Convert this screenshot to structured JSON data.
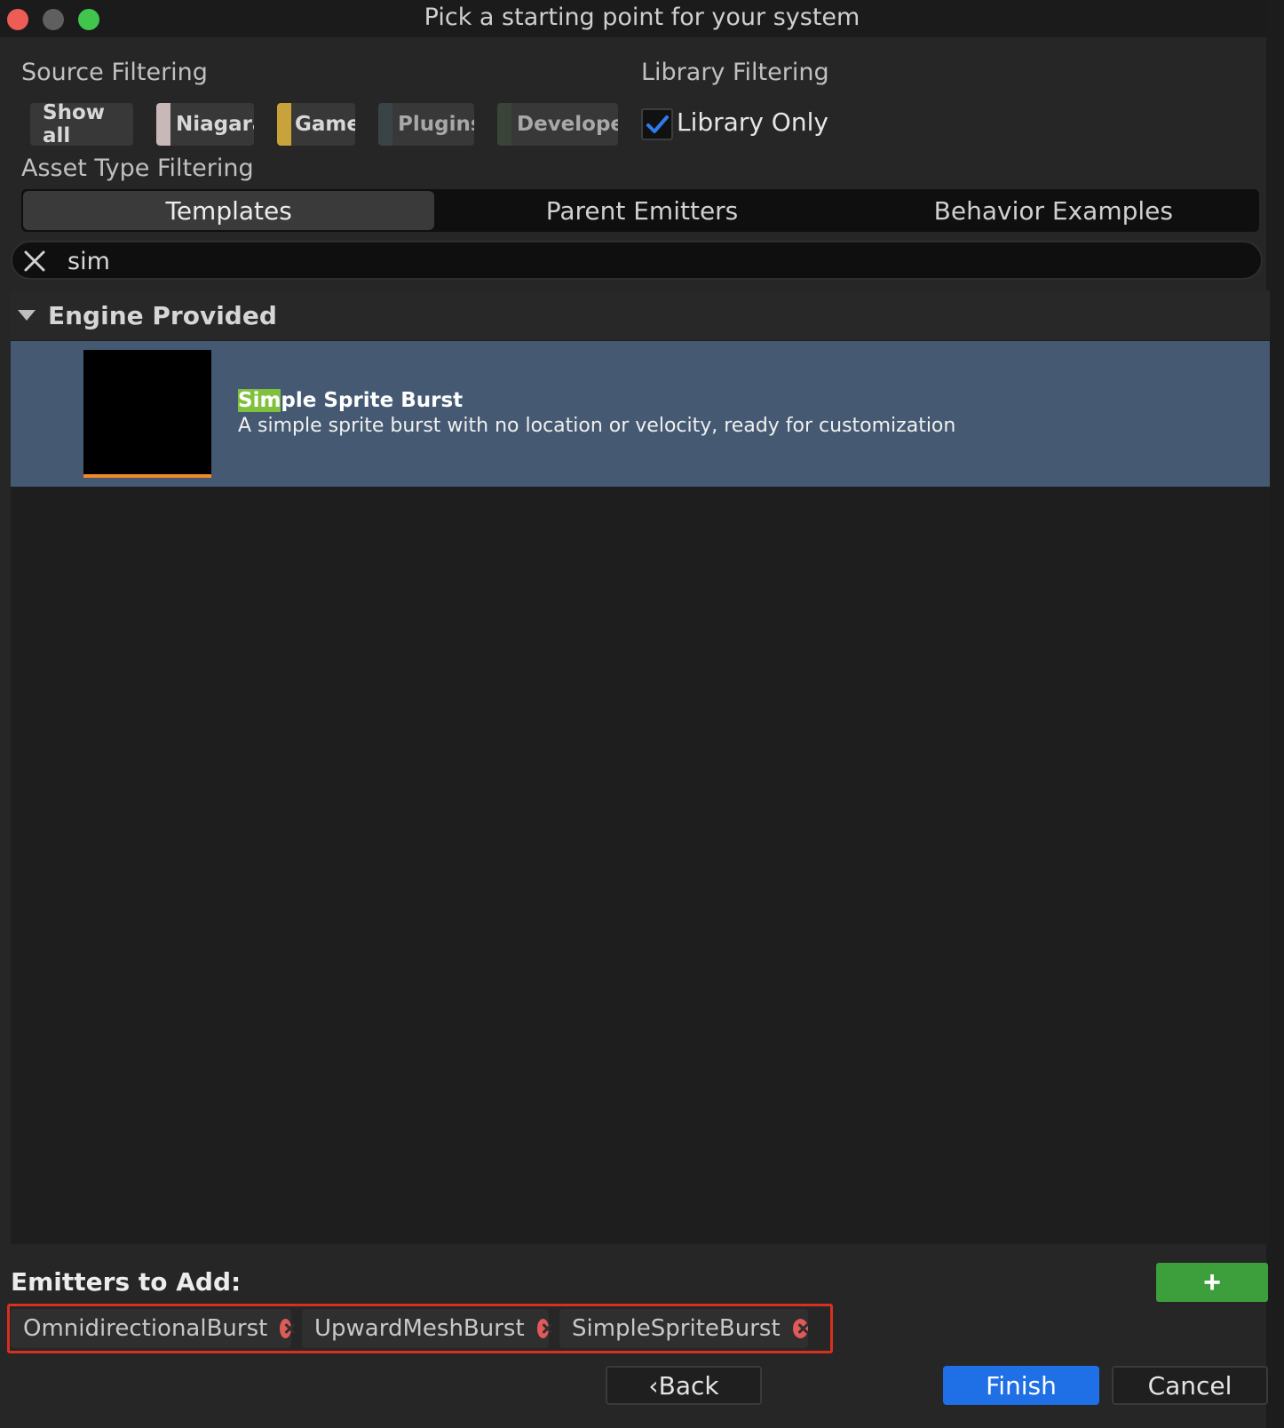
{
  "window": {
    "title": "Pick a starting point for your system"
  },
  "source_filtering": {
    "label": "Source Filtering",
    "chips": [
      {
        "label": "Show all",
        "active": false
      },
      {
        "label": "Niagara",
        "active": true,
        "color": "#c9b8b8"
      },
      {
        "label": "Game",
        "active": true,
        "color": "#c8a23a"
      },
      {
        "label": "Plugins",
        "active": false,
        "color": "#3a4446"
      },
      {
        "label": "Developer",
        "active": false,
        "color": "#3a4438"
      }
    ]
  },
  "library_filtering": {
    "label": "Library Filtering",
    "library_only_label": "Library Only",
    "library_only_checked": true
  },
  "asset_type": {
    "label": "Asset Type Filtering",
    "tabs": [
      "Templates",
      "Parent Emitters",
      "Behavior Examples"
    ],
    "active_tab": "Templates"
  },
  "search": {
    "value": "sim"
  },
  "results": {
    "group_title": "Engine Provided",
    "items": [
      {
        "title_match": "Sim",
        "title_rest": "ple Sprite Burst",
        "description": "A simple sprite burst with no location or velocity, ready for customization"
      }
    ]
  },
  "emitters_to_add": {
    "label": "Emitters to Add:",
    "add_button": "+",
    "items": [
      "OmnidirectionalBurst",
      "UpwardMeshBurst",
      "SimpleSpriteBurst"
    ]
  },
  "footer": {
    "back": "‹Back",
    "finish": "Finish",
    "cancel": "Cancel"
  },
  "colors": {
    "accent": "#1f6fe6",
    "selection": "#455a72",
    "add_button": "#3c9f3c",
    "highlight": "#7fc13c",
    "outline": "#d7301f"
  }
}
